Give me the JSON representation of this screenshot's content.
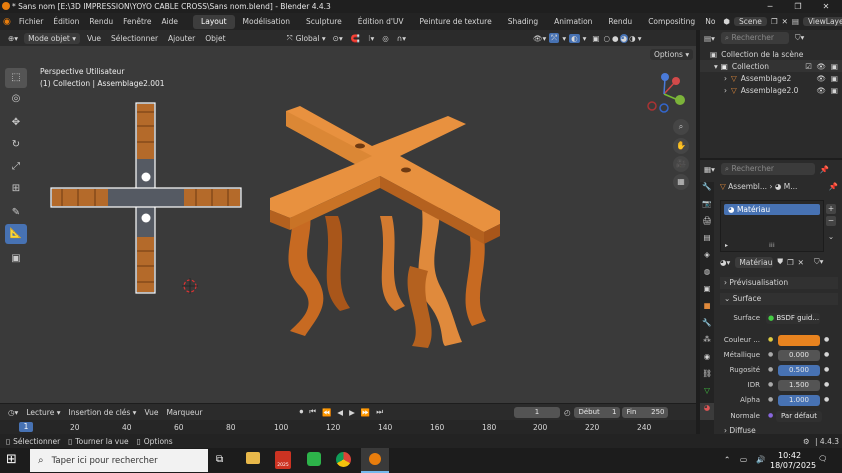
{
  "titlebar": {
    "title": "* Sans nom [E:\\3D IMPRESSION\\YOYO CABLE CROSS\\Sans nom.blend] - Blender 4.4.3",
    "minimize": "─",
    "maximize": "❐",
    "close": "✕"
  },
  "menu": {
    "items": [
      "Fichier",
      "Édition",
      "Rendu",
      "Fenêtre",
      "Aide"
    ],
    "workspaces": [
      "Layout",
      "Modélisation",
      "Sculpture",
      "Édition d'UV",
      "Peinture de texture",
      "Shading",
      "Animation",
      "Rendu",
      "Compositing",
      "No"
    ],
    "scene": "Scene",
    "viewlayer": "ViewLayer"
  },
  "header": {
    "mode": "Mode objet",
    "view": "Vue",
    "select": "Sélectionner",
    "add": "Ajouter",
    "object": "Objet",
    "transform": "Global",
    "search_placeholder": "Rechercher",
    "options": "Options"
  },
  "viewport": {
    "perspective": "Perspective Utilisateur",
    "collection_line": "(1) Collection | Assemblage2.001",
    "gizmo": {
      "x": "X",
      "y": "Y",
      "z": "Z"
    }
  },
  "outliner": {
    "root": "Collection de la scène",
    "collection": "Collection",
    "items": [
      "Assemblage2",
      "Assemblage2.0"
    ]
  },
  "properties": {
    "search_placeholder": "Rechercher",
    "breadcrumb1": "Assembl...",
    "breadcrumb2": "M...",
    "material_slot": "Matériau",
    "material_name": "Matériau",
    "sections": {
      "preview": "Prévisualisation",
      "surface": "Surface",
      "diffuse": "Diffuse"
    },
    "rows": [
      {
        "label": "Surface",
        "value": "BSDF guid..."
      },
      {
        "label": "Couleur ...",
        "value": ""
      },
      {
        "label": "Métallique",
        "value": "0.000"
      },
      {
        "label": "Rugosité",
        "value": "0.500"
      },
      {
        "label": "IDR",
        "value": "1.500"
      },
      {
        "label": "Alpha",
        "value": "1.000"
      },
      {
        "label": "Normale",
        "value": "Par défaut"
      }
    ],
    "color_hex": "#e8831f"
  },
  "timeline": {
    "playback": "Lecture",
    "keying": "Insertion de clés",
    "view": "Vue",
    "markers": "Marqueur",
    "current_frame": "1",
    "start_label": "Début",
    "start": "1",
    "end_label": "Fin",
    "end": "250"
  },
  "ruler": {
    "current": "1",
    "ticks": [
      "20",
      "40",
      "60",
      "80",
      "100",
      "120",
      "140",
      "160",
      "180",
      "200",
      "220",
      "240"
    ]
  },
  "status": {
    "select": "Sélectionner",
    "rotate": "Tourner la vue",
    "options": "Options",
    "version": "4.4.3"
  },
  "taskbar": {
    "search_placeholder": "Taper ici pour rechercher",
    "time": "10:42",
    "date": "18/07/2025",
    "badge": "2025"
  },
  "colors": {
    "accent": "#4772b3",
    "orange": "#e08a3c",
    "orange_dark": "#b4611f",
    "ui_bg": "#2b2b2b",
    "viewport_bg": "#3a3a3a"
  }
}
